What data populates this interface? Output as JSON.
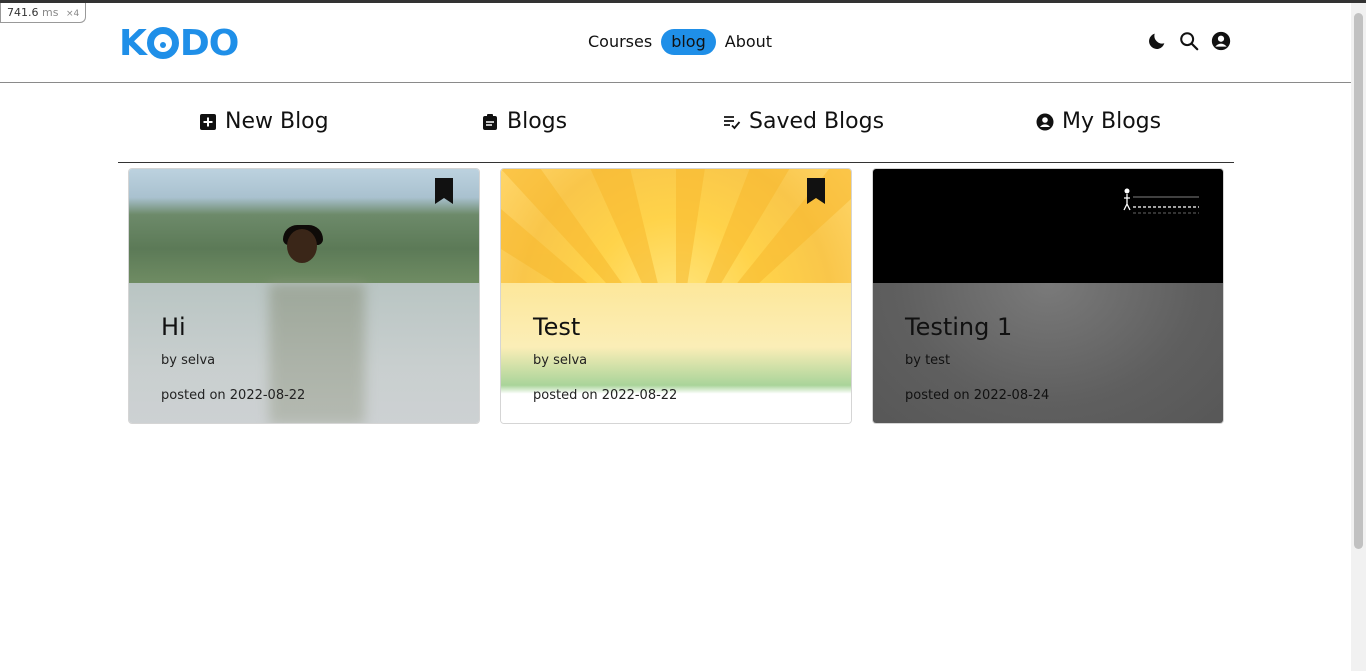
{
  "perf": {
    "value": "741.6",
    "unit": "ms",
    "multiplier": "×4"
  },
  "brand": {
    "logo_text_k": "K",
    "logo_text_do": "DO"
  },
  "nav": {
    "links": [
      {
        "label": "Courses"
      },
      {
        "label": "blog",
        "active": true
      },
      {
        "label": "About"
      }
    ],
    "icons": [
      "dark-mode-moon-icon",
      "search-icon",
      "account-icon"
    ]
  },
  "tabs": [
    {
      "label": "New Blog",
      "icon": "plus-square-icon"
    },
    {
      "label": "Blogs",
      "icon": "clipboard-icon"
    },
    {
      "label": "Saved Blogs",
      "icon": "list-check-icon"
    },
    {
      "label": "My Blogs",
      "icon": "user-circle-icon"
    }
  ],
  "blogs": [
    {
      "title": "Hi",
      "author": "by selva",
      "posted": "posted on 2022-08-22",
      "bookmark": true
    },
    {
      "title": "Test",
      "author": "by selva",
      "posted": "posted on 2022-08-22",
      "bookmark": true
    },
    {
      "title": "Testing 1",
      "author": "by test",
      "posted": "posted on 2022-08-24",
      "bookmark": false
    }
  ],
  "colors": {
    "accent": "#1f8fe8",
    "text": "#111111",
    "divider": "#8a8a8a"
  }
}
